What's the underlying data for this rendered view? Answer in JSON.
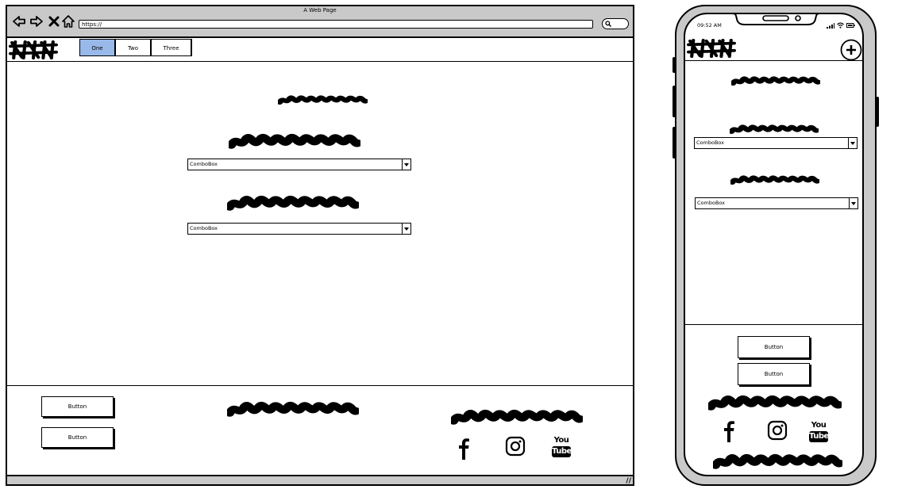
{
  "browser": {
    "title": "A Web Page",
    "url": "https://",
    "tabs": [
      "One",
      "Two",
      "Three"
    ],
    "active_tab": "One",
    "resize_grip": "//"
  },
  "desktop": {
    "combo1": "ComboBox",
    "combo2": "ComboBox",
    "button1": "Button",
    "button2": "Button",
    "social": {
      "youtube_top": "You",
      "youtube_bottom": "Tube"
    }
  },
  "phone": {
    "time": "09:52 AM",
    "combo1": "ComboBox",
    "combo2": "ComboBox",
    "button1": "Button",
    "button2": "Button",
    "social": {
      "youtube_top": "You",
      "youtube_bottom": "Tube"
    }
  },
  "colors": {
    "accent_tab": "#98b9ea",
    "chrome_gray": "#c9c9c9"
  },
  "icons": [
    "back-arrow-icon",
    "forward-arrow-icon",
    "close-icon",
    "home-icon",
    "search-icon",
    "logo-placeholder-icon",
    "facebook-icon",
    "instagram-icon",
    "youtube-icon",
    "plus-icon",
    "signal-icon",
    "wifi-icon",
    "battery-icon"
  ]
}
